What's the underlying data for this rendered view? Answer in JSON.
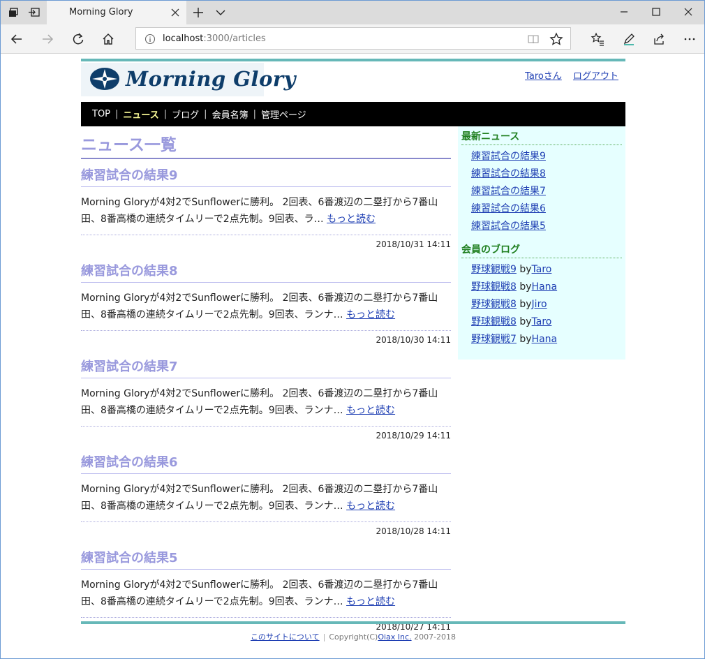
{
  "browser": {
    "tab_title": "Morning Glory",
    "url_host": "localhost",
    "url_rest": ":3000/articles"
  },
  "site": {
    "logo_text": "Morning Glory",
    "user_link": "Taroさん",
    "logout_link": "ログアウト",
    "menu": [
      {
        "label": "TOP",
        "active": false
      },
      {
        "label": "ニュース",
        "active": true
      },
      {
        "label": "ブログ",
        "active": false
      },
      {
        "label": "会員名簿",
        "active": false
      },
      {
        "label": "管理ページ",
        "active": false
      }
    ]
  },
  "main": {
    "title": "ニュース一覧",
    "more_label": "もっと読む",
    "articles": [
      {
        "title": "練習試合の結果9",
        "body": "Morning Gloryが4対2でSunflowerに勝利。 2回表、6番渡辺の二塁打から7番山田、8番高橋の連続タイムリーで2点先制。9回表、ラ…",
        "date": "2018/10/31 14:11"
      },
      {
        "title": "練習試合の結果8",
        "body": "Morning Gloryが4対2でSunflowerに勝利。 2回表、6番渡辺の二塁打から7番山田、8番高橋の連続タイムリーで2点先制。9回表、ランナ…",
        "date": "2018/10/30 14:11"
      },
      {
        "title": "練習試合の結果7",
        "body": "Morning Gloryが4対2でSunflowerに勝利。 2回表、6番渡辺の二塁打から7番山田、8番高橋の連続タイムリーで2点先制。9回表、ランナ…",
        "date": "2018/10/29 14:11"
      },
      {
        "title": "練習試合の結果6",
        "body": "Morning Gloryが4対2でSunflowerに勝利。 2回表、6番渡辺の二塁打から7番山田、8番高橋の連続タイムリーで2点先制。9回表、ランナ…",
        "date": "2018/10/28 14:11"
      },
      {
        "title": "練習試合の結果5",
        "body": "Morning Gloryが4対2でSunflowerに勝利。 2回表、6番渡辺の二塁打から7番山田、8番高橋の連続タイムリーで2点先制。9回表、ランナ…",
        "date": "2018/10/27 14:11"
      }
    ]
  },
  "sidebar": {
    "news_heading": "最新ニュース",
    "news": [
      "練習試合の結果9",
      "練習試合の結果8",
      "練習試合の結果7",
      "練習試合の結果6",
      "練習試合の結果5"
    ],
    "blog_heading": "会員のブログ",
    "by_label": "by",
    "blogs": [
      {
        "title": "野球観戦9",
        "author": "Taro"
      },
      {
        "title": "野球観戦8",
        "author": "Hana"
      },
      {
        "title": "野球観戦8",
        "author": "Jiro"
      },
      {
        "title": "野球観戦8",
        "author": "Taro"
      },
      {
        "title": "野球観戦7",
        "author": "Hana"
      }
    ]
  },
  "footer": {
    "about_link": "このサイトについて",
    "copyright_prefix": "Copyright(C)",
    "company_link": "Oiax Inc.",
    "years": "2007-2018"
  }
}
